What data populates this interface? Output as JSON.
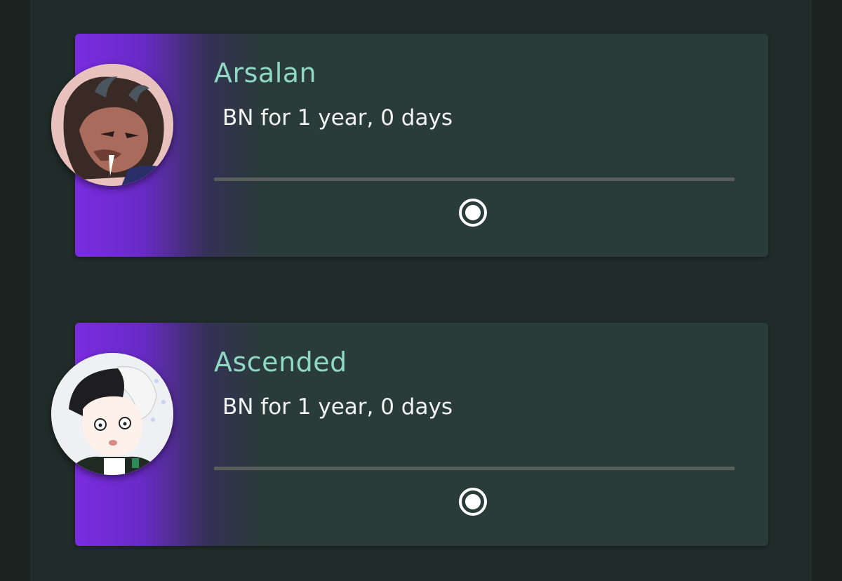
{
  "users": [
    {
      "name": "Arsalan",
      "tenure": "BN for 1 year, 0 days",
      "avatar_icon": "lion-demon-avatar",
      "accent_color": "#7a2de0",
      "name_color": "#8fd8c2"
    },
    {
      "name": "Ascended",
      "tenure": "BN for 1 year, 0 days",
      "avatar_icon": "anime-boy-avatar",
      "accent_color": "#7a2de0",
      "name_color": "#8fd8c2"
    }
  ],
  "colors": {
    "background": "#1b2321",
    "panel": "#202c29",
    "card": "#2a3c39",
    "divider": "#595e5c",
    "text": "#f2f4f3"
  }
}
